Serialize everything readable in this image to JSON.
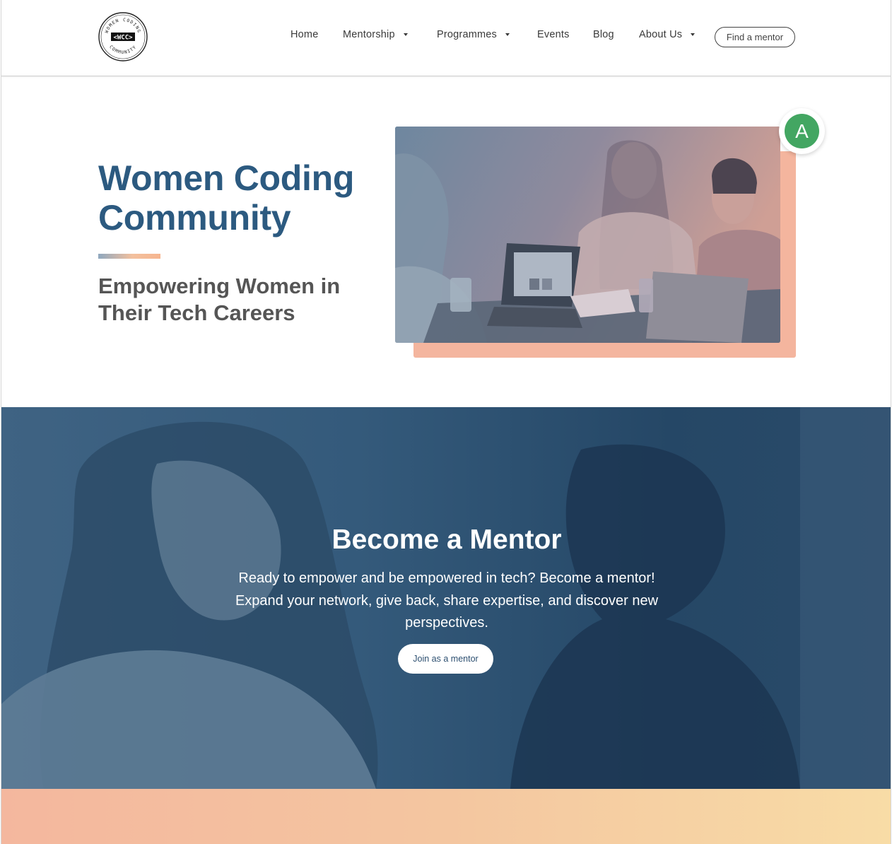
{
  "header": {
    "logo": {
      "label_top": "WOMEN CODING",
      "label_bottom": "COMMUNITY",
      "mark": "<WCC>",
      "icon": "wcc-logo"
    },
    "nav": [
      {
        "label": "Home",
        "dropdown": false
      },
      {
        "label": "Mentorship",
        "dropdown": true
      },
      {
        "label": "Programmes",
        "dropdown": true
      },
      {
        "label": "Events",
        "dropdown": false
      },
      {
        "label": "Blog",
        "dropdown": false
      },
      {
        "label": "About Us",
        "dropdown": true
      }
    ],
    "cta_label": "Find a mentor"
  },
  "hero": {
    "title": "Women Coding Community",
    "subtitle": "Empowering Women in Their Tech Careers",
    "image_alt": "Three women laughing around laptops",
    "avatar_letter": "A"
  },
  "mentor_section": {
    "title": "Become a Mentor",
    "text": "Ready to empower and be empowered in tech? Become a mentor! Expand your network, give back, share expertise, and discover new perspectives.",
    "button_label": "Join as a mentor"
  },
  "colors": {
    "brand_blue": "#2c5a80",
    "band_blue": "#2f5576",
    "accent_peach": "#f4b59e",
    "avatar_green": "#43a662"
  }
}
